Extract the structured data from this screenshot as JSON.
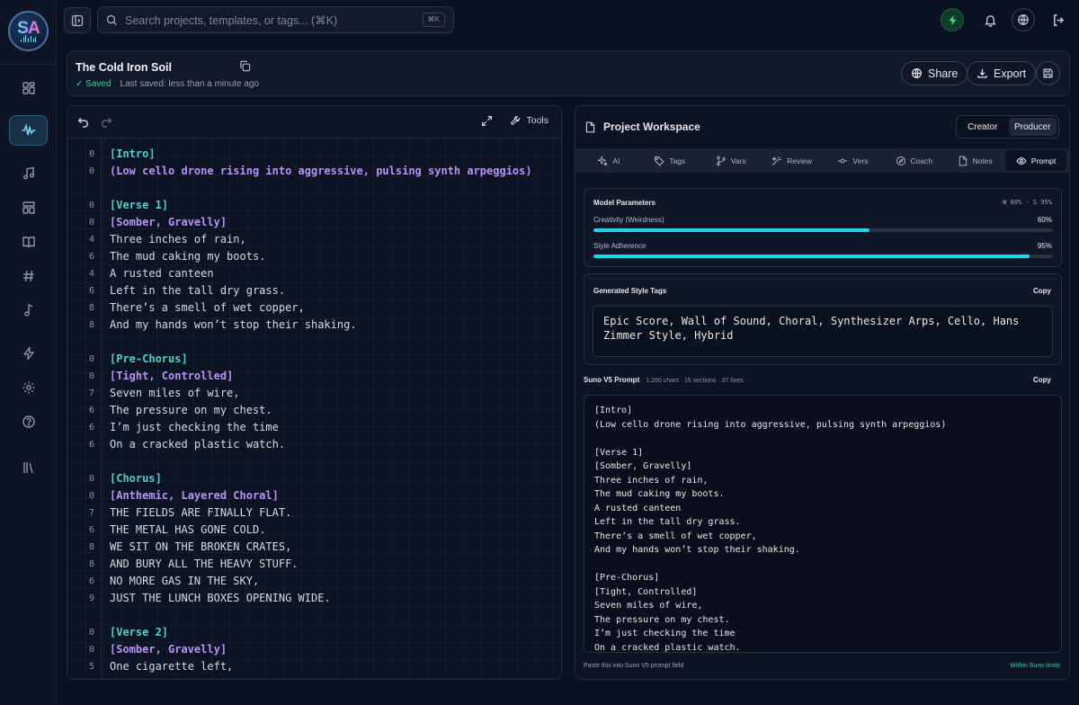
{
  "app": {
    "logo_text": "SA"
  },
  "search": {
    "placeholder": "Search projects, templates, or tags... (⌘K)",
    "shortcut": "⌘K"
  },
  "rail": {
    "items": [
      {
        "icon": "dashboard-icon"
      },
      {
        "icon": "waveform-icon",
        "active": true
      },
      {
        "icon": "music-note-icon"
      },
      {
        "icon": "templates-icon"
      },
      {
        "icon": "book-icon"
      },
      {
        "icon": "hash-icon"
      },
      {
        "icon": "note-icon"
      },
      {
        "icon": "bolt-icon"
      },
      {
        "icon": "gear-icon"
      },
      {
        "icon": "help-icon"
      },
      {
        "icon": "library-icon"
      }
    ]
  },
  "header": {
    "title": "The Cold Iron Soil",
    "saved": "✓ Saved",
    "last_saved": "Last saved: less than a minute ago",
    "share_label": "Share",
    "export_label": "Export"
  },
  "editor": {
    "tools_label": "Tools",
    "lines": [
      {
        "n": "0",
        "text": "[Intro]",
        "kind": "section"
      },
      {
        "n": "0",
        "text": "(Low cello drone rising into aggressive, pulsing synth arpeggios)",
        "kind": "direction"
      },
      {
        "n": "",
        "text": "",
        "kind": "blank"
      },
      {
        "n": "0",
        "text": "[Verse 1]",
        "kind": "section"
      },
      {
        "n": "0",
        "text": "[Somber, Gravelly]",
        "kind": "direction"
      },
      {
        "n": "4",
        "text": "Three inches of rain,",
        "kind": "lyric"
      },
      {
        "n": "6",
        "text": "The mud caking my boots.",
        "kind": "lyric"
      },
      {
        "n": "4",
        "text": "A rusted canteen",
        "kind": "lyric"
      },
      {
        "n": "6",
        "text": "Left in the tall dry grass.",
        "kind": "lyric"
      },
      {
        "n": "8",
        "text": "There’s a smell of wet copper,",
        "kind": "lyric"
      },
      {
        "n": "8",
        "text": "And my hands won’t stop their shaking.",
        "kind": "lyric"
      },
      {
        "n": "",
        "text": "",
        "kind": "blank"
      },
      {
        "n": "0",
        "text": "[Pre-Chorus]",
        "kind": "section"
      },
      {
        "n": "0",
        "text": "[Tight, Controlled]",
        "kind": "direction"
      },
      {
        "n": "7",
        "text": "Seven miles of wire,",
        "kind": "lyric"
      },
      {
        "n": "6",
        "text": "The pressure on my chest.",
        "kind": "lyric"
      },
      {
        "n": "6",
        "text": "I’m just checking the time",
        "kind": "lyric"
      },
      {
        "n": "6",
        "text": "On a cracked plastic watch.",
        "kind": "lyric"
      },
      {
        "n": "",
        "text": "",
        "kind": "blank"
      },
      {
        "n": "0",
        "text": "[Chorus]",
        "kind": "section"
      },
      {
        "n": "0",
        "text": "[Anthemic, Layered Choral]",
        "kind": "direction"
      },
      {
        "n": "7",
        "text": "THE FIELDS ARE FINALLY FLAT.",
        "kind": "lyric"
      },
      {
        "n": "6",
        "text": "THE METAL HAS GONE COLD.",
        "kind": "lyric"
      },
      {
        "n": "8",
        "text": "WE SIT ON THE BROKEN CRATES,",
        "kind": "lyric"
      },
      {
        "n": "8",
        "text": "AND BURY ALL THE HEAVY STUFF.",
        "kind": "lyric"
      },
      {
        "n": "6",
        "text": "NO MORE GAS IN THE SKY,",
        "kind": "lyric"
      },
      {
        "n": "9",
        "text": "JUST THE LUNCH BOXES OPENING WIDE.",
        "kind": "lyric"
      },
      {
        "n": "",
        "text": "",
        "kind": "blank"
      },
      {
        "n": "0",
        "text": "[Verse 2]",
        "kind": "section"
      },
      {
        "n": "0",
        "text": "[Somber, Gravelly]",
        "kind": "direction"
      },
      {
        "n": "5",
        "text": "One cigarette left,",
        "kind": "lyric"
      }
    ]
  },
  "workspace": {
    "title": "Project Workspace",
    "modes": [
      "Creator",
      "Producer"
    ],
    "active_mode": "Producer",
    "tabs": [
      {
        "label": "AI",
        "icon": "sparkles-icon"
      },
      {
        "label": "Tags",
        "icon": "tags-icon"
      },
      {
        "label": "Vars",
        "icon": "branch-icon"
      },
      {
        "label": "Review",
        "icon": "wand-icon"
      },
      {
        "label": "Vers",
        "icon": "commit-icon"
      },
      {
        "label": "Coach",
        "icon": "compass-icon"
      },
      {
        "label": "Notes",
        "icon": "file-icon"
      },
      {
        "label": "Prompt",
        "icon": "eye-icon",
        "active": true
      }
    ],
    "params": {
      "title": "Model Parameters",
      "summary": "W 60% · S 95%",
      "creativity_label": "Creativity (Weirdness)",
      "creativity_value": "60%",
      "creativity_fraction": 0.6,
      "style_label": "Style Adherence",
      "style_value": "95%",
      "style_fraction": 0.95
    },
    "style_tags": {
      "title": "Generated Style Tags",
      "copy": "Copy",
      "text": "Epic Score, Wall of Sound, Choral, Synthesizer Arps, Cello, Hans Zimmer Style, Hybrid"
    },
    "prompt": {
      "title": "Suno V5 Prompt",
      "meta": "1,260 chars · 15 sections · 37 lines",
      "copy": "Copy",
      "lines": [
        "[Intro]",
        "(Low cello drone rising into aggressive, pulsing synth arpeggios)",
        "",
        "[Verse 1]",
        "[Somber, Gravelly]",
        "Three inches of rain,",
        "The mud caking my boots.",
        "A rusted canteen",
        "Left in the tall dry grass.",
        "There’s a smell of wet copper,",
        "And my hands won’t stop their shaking.",
        "",
        "[Pre-Chorus]",
        "[Tight, Controlled]",
        "Seven miles of wire,",
        "The pressure on my chest.",
        "I’m just checking the time",
        "On a cracked plastic watch."
      ],
      "footer_hint": "Paste this into Suno V5 prompt field",
      "footer_status": "Within Suno limits"
    }
  }
}
